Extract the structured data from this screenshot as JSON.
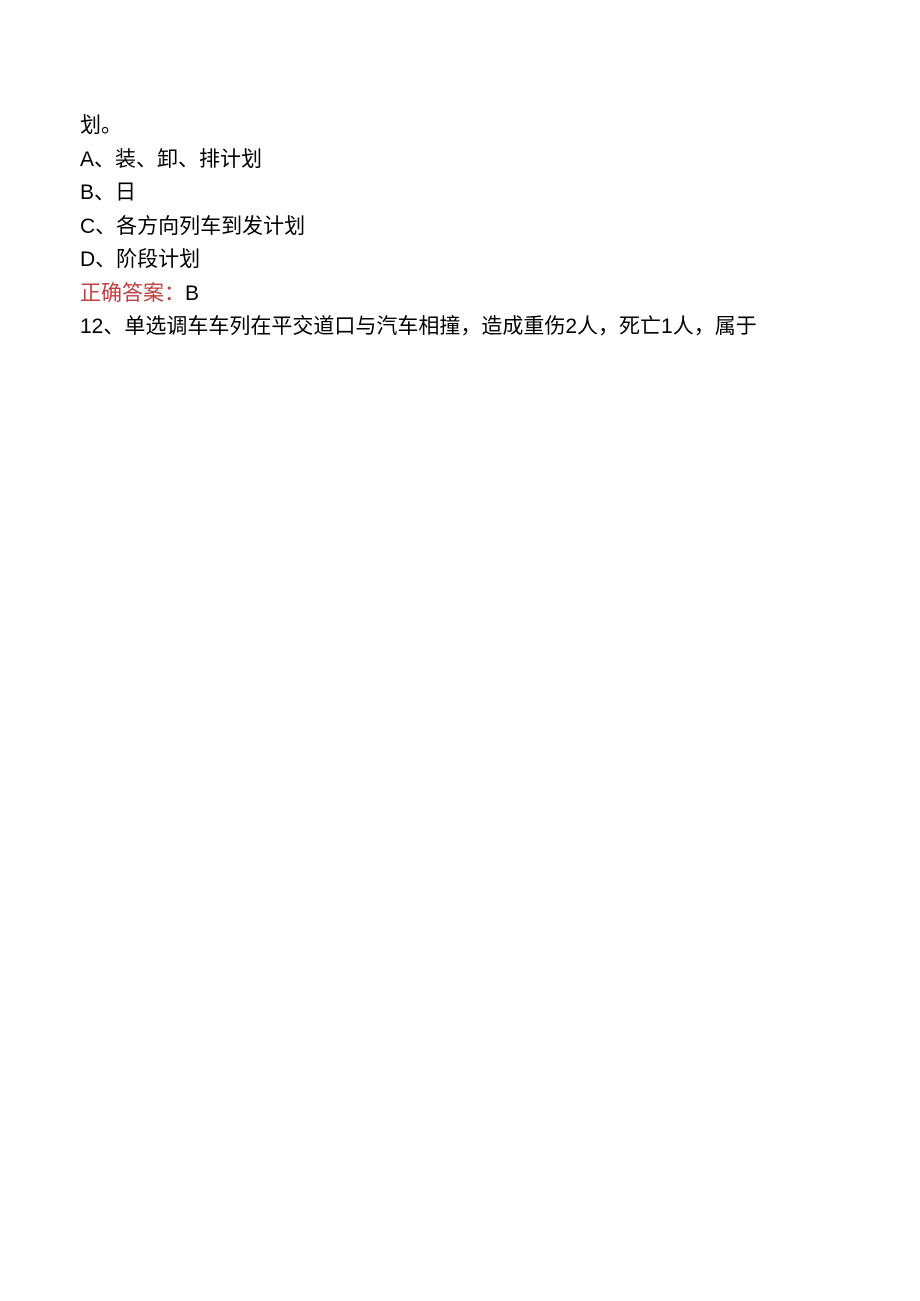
{
  "content": {
    "line1": "划。",
    "optA_letter": "A",
    "optA_text": "、装、卸、排计划",
    "optB_letter": "B",
    "optB_text": "、日",
    "optC_letter": "C",
    "optC_text": "、各方向列车到发计划",
    "optD_letter": "D",
    "optD_text": "、阶段计划",
    "answer_label": "正确答案：",
    "answer_value": "B",
    "q12_num": "12",
    "q12_part1": "、单选调车车列在平交道口与汽车相撞，造成重伤",
    "q12_n2": "2",
    "q12_part2": "人，死亡",
    "q12_n1": "1",
    "q12_part3": "人，属于"
  }
}
